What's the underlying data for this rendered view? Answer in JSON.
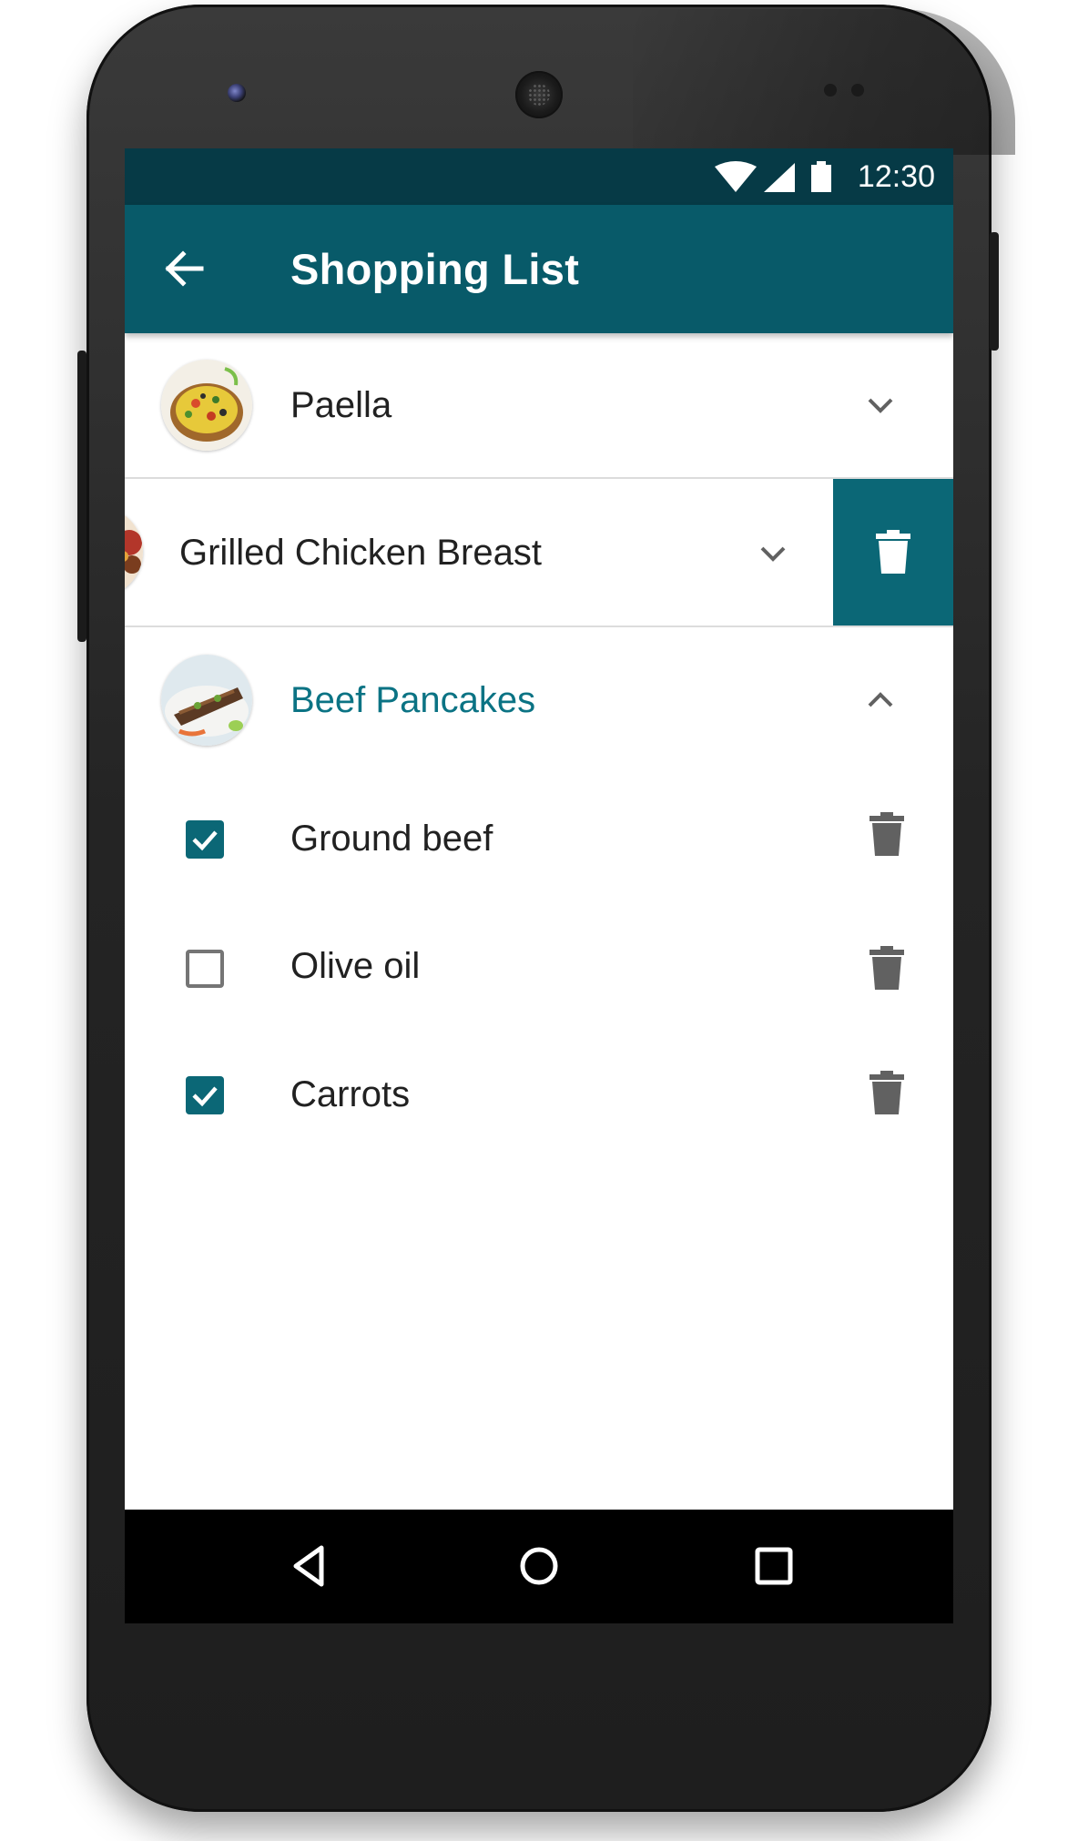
{
  "colors": {
    "status_bar": "#063a46",
    "app_bar": "#085a69",
    "accent": "#0b7384",
    "delete_bg": "#0b6776"
  },
  "status_bar": {
    "time": "12:30",
    "icons": [
      "wifi-icon",
      "cellular-signal-icon",
      "battery-icon"
    ]
  },
  "app_bar": {
    "back_icon": "arrow-back-icon",
    "title": "Shopping List"
  },
  "recipes": [
    {
      "name": "Paella",
      "image": "paella-thumbnail",
      "expanded": false,
      "icon": "chevron-down-icon"
    },
    {
      "name": "Grilled Chicken Breast",
      "image": "grilled-chicken-thumbnail",
      "expanded": false,
      "icon": "chevron-down-icon",
      "swipe_action_icon": "trash-icon"
    },
    {
      "name": "Beef Pancakes",
      "image": "beef-pancakes-thumbnail",
      "expanded": true,
      "icon": "chevron-up-icon"
    }
  ],
  "ingredients": [
    {
      "name": "Ground beef",
      "checked": true
    },
    {
      "name": "Olive oil",
      "checked": false
    },
    {
      "name": "Carrots",
      "checked": true
    }
  ],
  "nav_bar": {
    "buttons": [
      "back-triangle-icon",
      "home-circle-icon",
      "recents-square-icon"
    ]
  }
}
